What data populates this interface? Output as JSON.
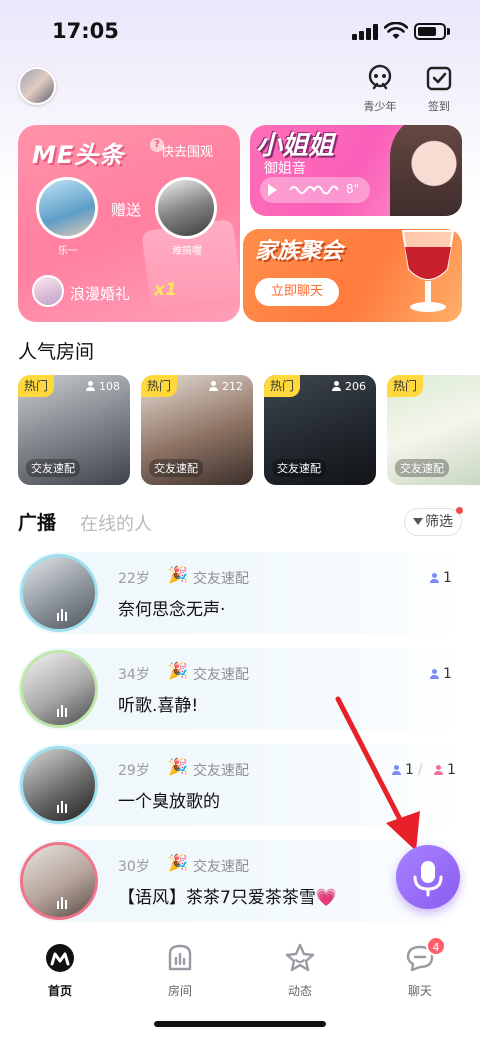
{
  "status_bar": {
    "time": "17:05"
  },
  "header": {
    "teen_mode_label": "青少年",
    "checkin_label": "签到"
  },
  "banners": {
    "me_headline": {
      "title": "ME头条",
      "link": "快去围观",
      "send_label": "赠送",
      "sender_name": "乐一",
      "receiver_name": "难搞喔",
      "gift_name": "浪漫婚礼",
      "gift_count": "x1"
    },
    "xiaojiejie": {
      "title": "小姐姐",
      "subtitle": "御姐音",
      "duration": "8\""
    },
    "family": {
      "title": "家族聚会",
      "button": "立即聊天"
    }
  },
  "popular_rooms": {
    "title": "人气房间",
    "rooms": [
      {
        "badge": "热门",
        "count": "108",
        "tag": "交友速配"
      },
      {
        "badge": "热门",
        "count": "212",
        "tag": "交友速配"
      },
      {
        "badge": "热门",
        "count": "206",
        "tag": "交友速配"
      },
      {
        "badge": "热门",
        "count": "",
        "tag": "交友速配"
      }
    ]
  },
  "tabs": {
    "active": "广播",
    "inactive": "在线的人",
    "filter": "筛选"
  },
  "broadcasts": [
    {
      "age": "22岁",
      "tag": "交友速配",
      "text": "奈何思念无声·",
      "count_blue": "1",
      "count_pink": ""
    },
    {
      "age": "34岁",
      "tag": "交友速配",
      "text": "听歌.喜静!",
      "count_blue": "1",
      "count_pink": ""
    },
    {
      "age": "29岁",
      "tag": "交友速配",
      "text": "一个臭放歌的",
      "count_blue": "1",
      "count_pink": "1"
    },
    {
      "age": "30岁",
      "tag": "交友速配",
      "text": "【语风】茶茶7只爱茶茶雪💗",
      "count_blue": "",
      "count_pink": ""
    }
  ],
  "bottom_nav": {
    "items": [
      {
        "label": "首页",
        "icon": "home-icon"
      },
      {
        "label": "房间",
        "icon": "room-icon"
      },
      {
        "label": "动态",
        "icon": "star-icon"
      },
      {
        "label": "聊天",
        "icon": "chat-icon",
        "badge": "4"
      }
    ]
  },
  "colors": {
    "accent": "#8a5cf0",
    "pink": "#ff7fa0",
    "orange": "#ff7a3d",
    "hot_badge": "#ffd83d"
  }
}
